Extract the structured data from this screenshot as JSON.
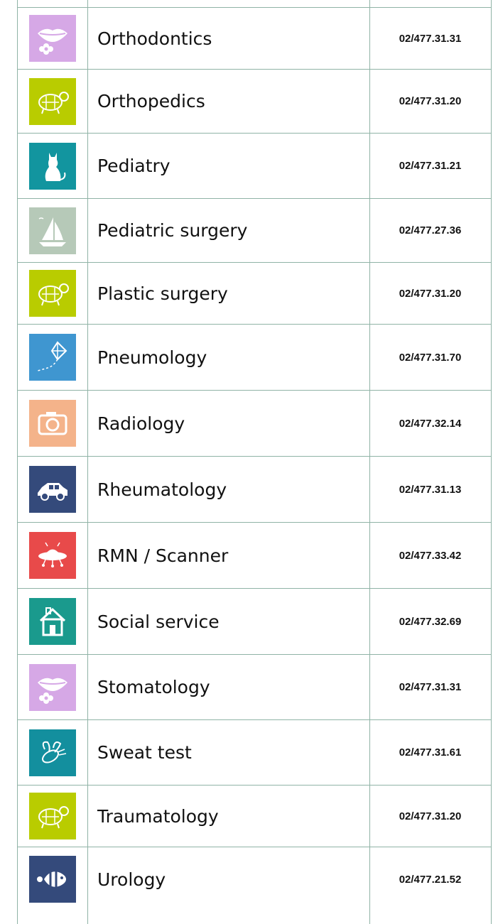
{
  "rows": [
    {
      "name": "Orthodontics",
      "phone": "02/477.31.31",
      "icon": "lips-flower-icon",
      "color": "#d6a8e6"
    },
    {
      "name": "Orthopedics",
      "phone": "02/477.31.20",
      "icon": "turtle-icon",
      "color": "#b9cc00"
    },
    {
      "name": "Pediatry",
      "phone": "02/477.31.21",
      "icon": "cat-icon",
      "color": "#12959f"
    },
    {
      "name": "Pediatric surgery",
      "phone": "02/477.27.36",
      "icon": "sailboat-icon",
      "color": "#b6c9b8"
    },
    {
      "name": "Plastic surgery",
      "phone": "02/477.31.20",
      "icon": "turtle-icon",
      "color": "#b9cc00"
    },
    {
      "name": "Pneumology",
      "phone": "02/477.31.70",
      "icon": "kite-icon",
      "color": "#3f96d0"
    },
    {
      "name": "Radiology",
      "phone": "02/477.32.14",
      "icon": "camera-icon",
      "color": "#f4b38a"
    },
    {
      "name": "Rheumatology",
      "phone": "02/477.31.13",
      "icon": "car-icon",
      "color": "#344a7b"
    },
    {
      "name": "RMN / Scanner",
      "phone": "02/477.33.42",
      "icon": "ufo-icon",
      "color": "#e84a4a"
    },
    {
      "name": "Social service",
      "phone": "02/477.32.69",
      "icon": "house-icon",
      "color": "#1a9a8d"
    },
    {
      "name": "Stomatology",
      "phone": "02/477.31.31",
      "icon": "lips-flower-icon",
      "color": "#d6a8e6"
    },
    {
      "name": "Sweat test",
      "phone": "02/477.31.61",
      "icon": "bee-icon",
      "color": "#138f9e"
    },
    {
      "name": "Traumatology",
      "phone": "02/477.31.20",
      "icon": "turtle-icon",
      "color": "#b9cc00"
    },
    {
      "name": "Urology",
      "phone": "02/477.21.52",
      "icon": "fish-icon",
      "color": "#344a7b"
    }
  ]
}
